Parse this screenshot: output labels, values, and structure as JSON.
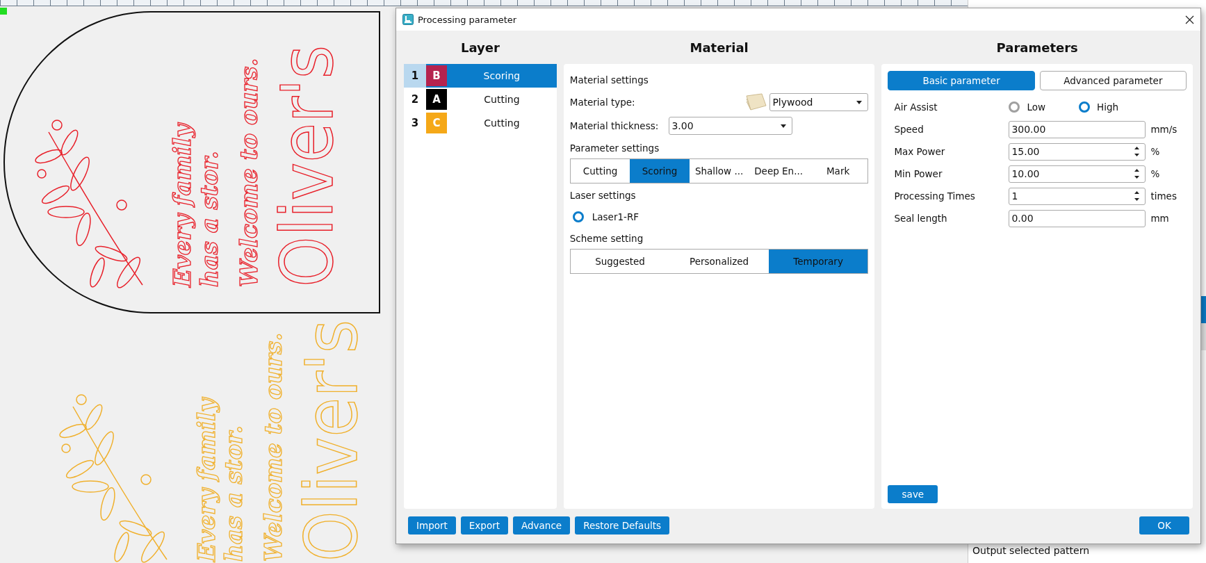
{
  "canvas": {
    "designs": [
      {
        "color": "#e8202a",
        "framed": true,
        "lines": [
          "Every family",
          "has a stor.",
          "Welcome to ours."
        ],
        "name": "Oliver's"
      },
      {
        "color": "#f0b02c",
        "framed": false,
        "lines": [
          "Every family",
          "has a stor.",
          "Welcome to ours."
        ],
        "name": "Oliver's"
      }
    ]
  },
  "side_panel": {
    "caption": "Output selected pattern"
  },
  "dialog": {
    "title": "Processing parameter",
    "layer": {
      "heading": "Layer",
      "items": [
        {
          "number": "1",
          "letter": "B",
          "color": "#b5234f",
          "mode": "Scoring",
          "selected": true
        },
        {
          "number": "2",
          "letter": "A",
          "color": "#000000",
          "mode": "Cutting",
          "selected": false
        },
        {
          "number": "3",
          "letter": "C",
          "color": "#f5a818",
          "mode": "Cutting",
          "selected": false
        }
      ]
    },
    "material": {
      "heading": "Material",
      "section_title": "Material settings",
      "type_label": "Material type:",
      "type_value": "Plywood",
      "thickness_label": "Material thickness:",
      "thickness_value": "3.00",
      "parameter_title": "Parameter settings",
      "parameter_options": [
        {
          "label": "Cutting",
          "selected": false
        },
        {
          "label": "Scoring",
          "selected": true
        },
        {
          "label": "Shallow ...",
          "selected": false
        },
        {
          "label": "Deep En...",
          "selected": false
        },
        {
          "label": "Mark",
          "selected": false
        }
      ],
      "laser_title": "Laser settings",
      "lasers": [
        {
          "label": "Laser1-RF",
          "selected": true
        }
      ],
      "scheme_title": "Scheme setting",
      "scheme_options": [
        {
          "label": "Suggested",
          "selected": false
        },
        {
          "label": "Personalized",
          "selected": false
        },
        {
          "label": "Temporary",
          "selected": true
        }
      ]
    },
    "parameters": {
      "heading": "Parameters",
      "tabs": [
        {
          "label": "Basic parameter",
          "selected": true
        },
        {
          "label": "Advanced parameter",
          "selected": false
        }
      ],
      "air_assist": {
        "label": "Air Assist",
        "options": [
          {
            "label": "Low",
            "selected": false
          },
          {
            "label": "High",
            "selected": true
          }
        ]
      },
      "fields": [
        {
          "label": "Speed",
          "value": "300.00",
          "unit": "mm/s",
          "kind": "text"
        },
        {
          "label": "Max Power",
          "value": "15.00",
          "unit": "%",
          "kind": "spin"
        },
        {
          "label": "Min Power",
          "value": "10.00",
          "unit": "%",
          "kind": "spin"
        },
        {
          "label": "Processing Times",
          "value": "1",
          "unit": "times",
          "kind": "spin"
        },
        {
          "label": "Seal length",
          "value": "0.00",
          "unit": "mm",
          "kind": "text"
        }
      ],
      "save": "save"
    },
    "footer_buttons": [
      "Import",
      "Export",
      "Advance",
      "Restore Defaults"
    ],
    "ok": "OK"
  }
}
